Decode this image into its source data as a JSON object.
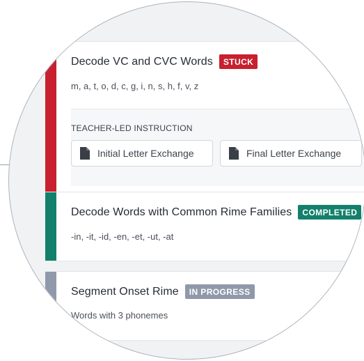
{
  "cards": [
    {
      "title": "Decode VC and CVC Words",
      "badge": "STUCK",
      "subtitle": "m, a, t, o, d, c, g, i, n, s, h, f, v, z",
      "color": "#c8202e",
      "teacher": {
        "heading": "TEACHER-LED INSTRUCTION",
        "buttons": [
          {
            "label": "Initial Letter Exchange",
            "icon": "document-icon"
          },
          {
            "label": "Final Letter Exchange",
            "icon": "document-icon"
          }
        ]
      }
    },
    {
      "title": "Decode Words with Common Rime Families",
      "badge": "COMPLETED",
      "subtitle": "-in, -it, -id, -en, -et, -ut, -at",
      "color": "#13806b"
    },
    {
      "title": "Segment Onset Rime",
      "badge": "IN PROGRESS",
      "subtitle": "Words with 3 phonemes",
      "color": "#8f99aa"
    }
  ]
}
